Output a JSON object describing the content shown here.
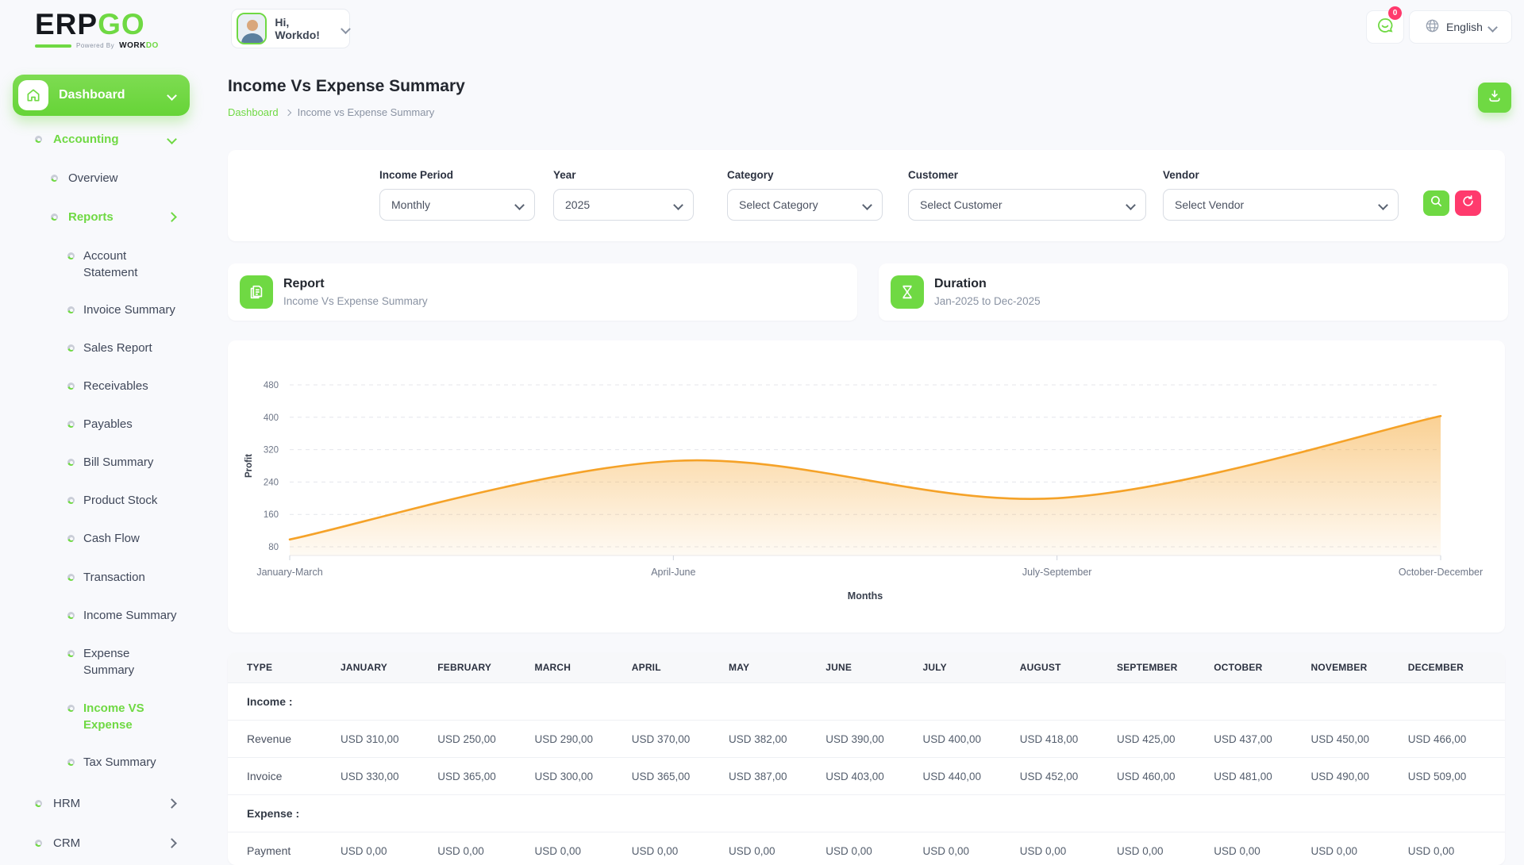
{
  "colors": {
    "accent_green": "#6fd943",
    "pink": "#ff3a6d",
    "chart_orange": "#f5a228",
    "text_dark": "#23272f",
    "text_gray": "#8a93a3"
  },
  "icons": {
    "home": "house-outline",
    "chat": "speech-bubble-smile",
    "globe": "globe",
    "download": "download-tray",
    "search": "magnifier",
    "reset": "refresh-arrows",
    "report": "document-pages",
    "duration": "hourglass",
    "chevron_down": "chevron-down",
    "chevron_right": "chevron-right",
    "bullet": "two-tone-ring"
  },
  "brand": {
    "erp": "ERP",
    "go": "GO",
    "powered_by": "Powered By",
    "work": "WORK",
    "do": "DO"
  },
  "header": {
    "greeting": "Hi, Workdo!",
    "notification_count": "0",
    "language": "English"
  },
  "sidebar": {
    "dashboard": "Dashboard",
    "accounting": "Accounting",
    "overview": "Overview",
    "reports": "Reports",
    "account_statement": "Account Statement",
    "invoice_summary": "Invoice Summary",
    "sales_report": "Sales Report",
    "receivables": "Receivables",
    "payables": "Payables",
    "bill_summary": "Bill Summary",
    "product_stock": "Product Stock",
    "cash_flow": "Cash Flow",
    "transaction": "Transaction",
    "income_summary": "Income Summary",
    "expense_summary": "Expense Summary",
    "income_vs_expense": "Income VS Expense",
    "tax_summary": "Tax Summary",
    "hrm": "HRM",
    "crm": "CRM"
  },
  "page": {
    "title": "Income Vs Expense Summary",
    "breadcrumb_home": "Dashboard",
    "breadcrumb_current": "Income vs Expense Summary"
  },
  "filters": {
    "income_period": {
      "label": "Income Period",
      "value": "Monthly"
    },
    "year": {
      "label": "Year",
      "value": "2025"
    },
    "category": {
      "label": "Category",
      "value": "Select Category"
    },
    "customer": {
      "label": "Customer",
      "value": "Select Customer"
    },
    "vendor": {
      "label": "Vendor",
      "value": "Select Vendor"
    }
  },
  "cards": {
    "report": {
      "title": "Report",
      "subtitle": "Income Vs Expense Summary"
    },
    "duration": {
      "title": "Duration",
      "subtitle": "Jan-2025 to Dec-2025"
    }
  },
  "chart_data": {
    "type": "area",
    "x": [
      "January-March",
      "April-June",
      "July-September",
      "October-December"
    ],
    "series": [
      {
        "name": "Profit",
        "values": [
          98,
          292,
          200,
          403
        ]
      }
    ],
    "title": "",
    "xlabel": "Months",
    "ylabel": "Profit",
    "yticks": [
      80,
      160,
      240,
      320,
      400,
      480
    ],
    "ylim": [
      80,
      480
    ],
    "grid": "dashed-horizontal",
    "legend": "none",
    "line_color": "#f5a228"
  },
  "table": {
    "columns": [
      "TYPE",
      "JANUARY",
      "FEBRUARY",
      "MARCH",
      "APRIL",
      "MAY",
      "JUNE",
      "JULY",
      "AUGUST",
      "SEPTEMBER",
      "OCTOBER",
      "NOVEMBER",
      "DECEMBER"
    ],
    "sections": [
      {
        "label": "Income :",
        "rows": [
          {
            "name": "Revenue",
            "values": [
              "USD 310,00",
              "USD 250,00",
              "USD 290,00",
              "USD 370,00",
              "USD 382,00",
              "USD 390,00",
              "USD 400,00",
              "USD 418,00",
              "USD 425,00",
              "USD 437,00",
              "USD 450,00",
              "USD 466,00"
            ]
          },
          {
            "name": "Invoice",
            "values": [
              "USD 330,00",
              "USD 365,00",
              "USD 300,00",
              "USD 365,00",
              "USD 387,00",
              "USD 403,00",
              "USD 440,00",
              "USD 452,00",
              "USD 460,00",
              "USD 481,00",
              "USD 490,00",
              "USD 509,00"
            ]
          }
        ]
      },
      {
        "label": "Expense :",
        "rows": [
          {
            "name": "Payment",
            "values": [
              "USD 0,00",
              "USD 0,00",
              "USD 0,00",
              "USD 0,00",
              "USD 0,00",
              "USD 0,00",
              "USD 0,00",
              "USD 0,00",
              "USD 0,00",
              "USD 0,00",
              "USD 0,00",
              "USD 0,00"
            ]
          }
        ]
      }
    ]
  }
}
